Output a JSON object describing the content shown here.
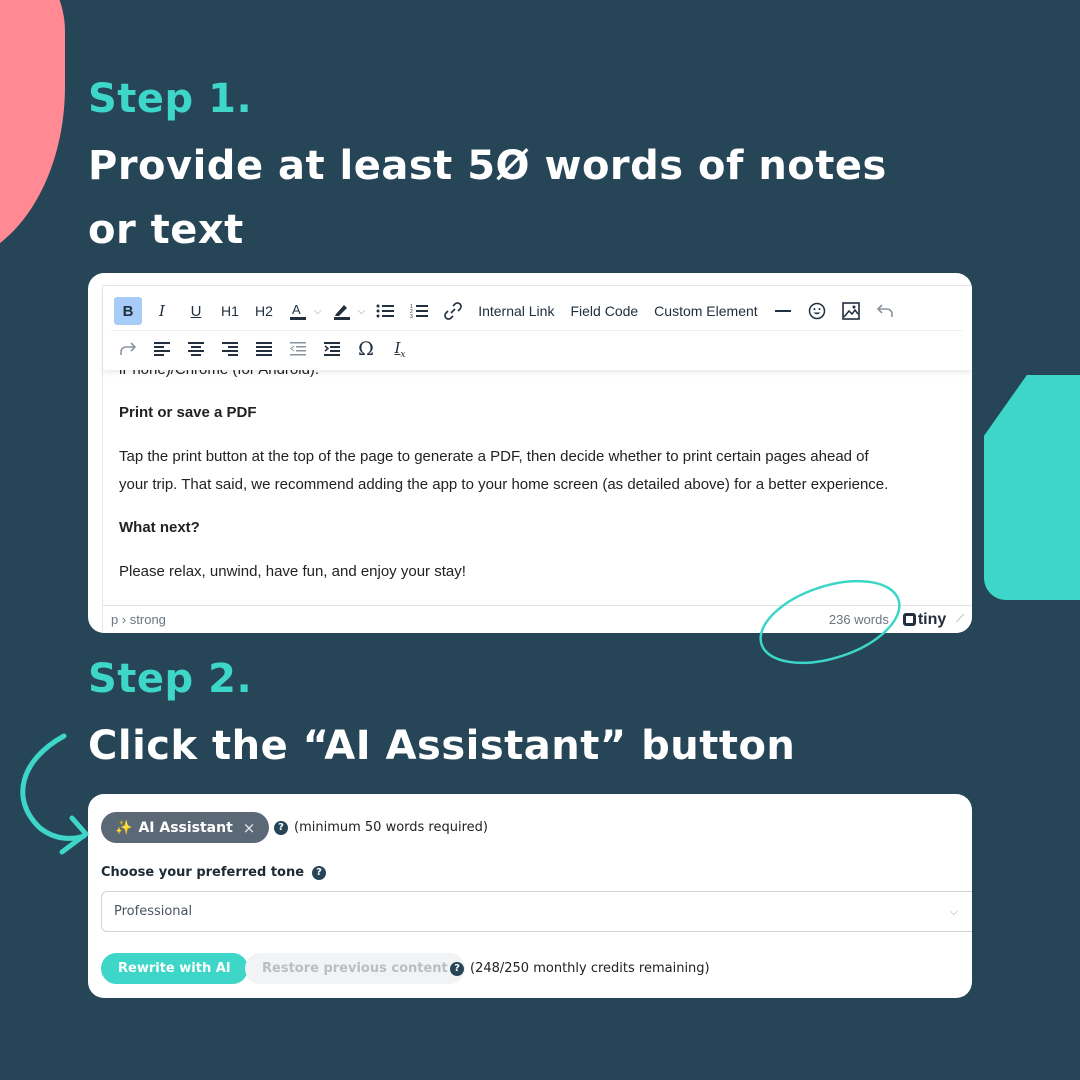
{
  "step1": {
    "label": "Step 1.",
    "text_line1": "Provide at least 5Ø words of notes",
    "text_line2": "or text"
  },
  "editor": {
    "toolbar_row1": [
      {
        "name": "bold-button",
        "label": "B",
        "icon": "bold-icon"
      },
      {
        "name": "italic-button",
        "label": "I",
        "icon": "italic-icon"
      },
      {
        "name": "underline-button",
        "label": "U",
        "icon": "underline-icon"
      },
      {
        "name": "h1-button",
        "label": "H1"
      },
      {
        "name": "h2-button",
        "label": "H2"
      }
    ],
    "text_buttons": {
      "internal_link": "Internal Link",
      "field_code": "Field Code",
      "custom_element": "Custom Element"
    },
    "content": {
      "line_partial": "iPhone)/Chrome (for Android).",
      "heading1": "Print or save a PDF",
      "para1_line1": "Tap the print button at the top of the page to generate a PDF, then decide whether to print certain pages ahead of",
      "para1_line2": "your trip. That said, we recommend adding the app to your home screen (as detailed above) for a better experience.",
      "heading2": "What next?",
      "para2": "Please relax, unwind, have fun, and enjoy your stay!"
    },
    "status": {
      "path": "p › strong",
      "word_count": "236 words",
      "brand": "tiny"
    }
  },
  "step2": {
    "label": "Step 2.",
    "text": "Click the “AI Assistant” button"
  },
  "ai_panel": {
    "chip_label": "AI Assistant",
    "chip_spark": "✨",
    "chip_close": "×",
    "min_note": "(minimum 50 words required)",
    "tone_label": "Choose your preferred tone",
    "tone_value": "Professional",
    "rewrite_label": "Rewrite with AI",
    "restore_label": "Restore previous content",
    "credits": "(248/250 monthly credits remaining)"
  },
  "colors": {
    "background": "#264557",
    "accent_teal": "#3dd6c8",
    "accent_pink": "#ff8a94",
    "chip_gray": "#5b6876"
  }
}
